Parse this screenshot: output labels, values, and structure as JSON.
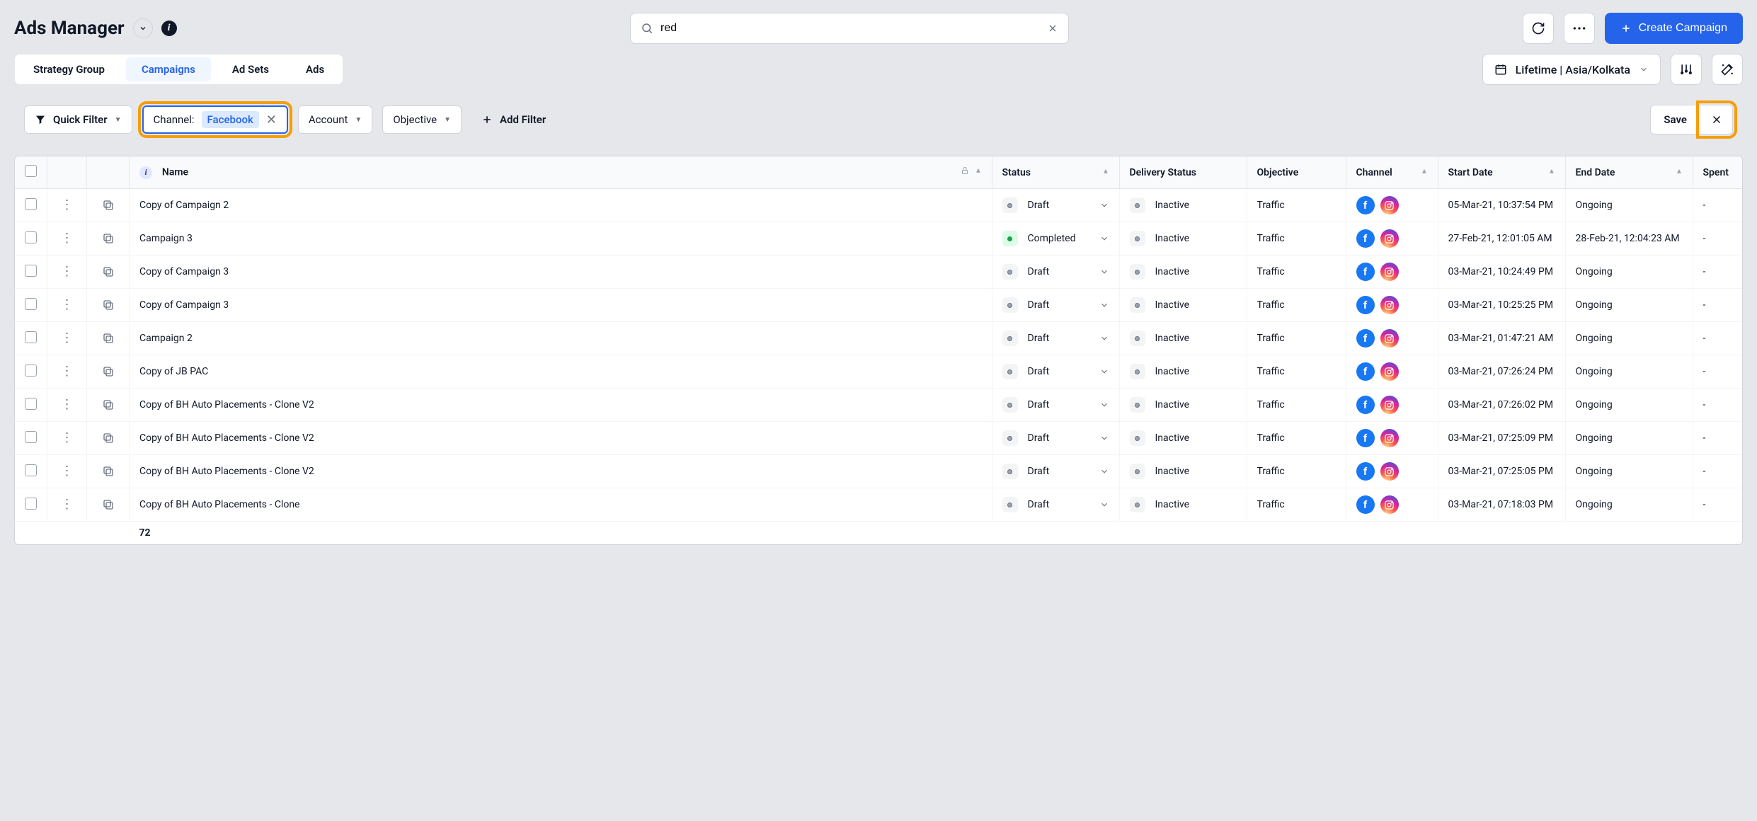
{
  "header": {
    "title": "Ads Manager",
    "search_value": "red",
    "create_label": "Create Campaign"
  },
  "tabs": {
    "items": [
      "Strategy Group",
      "Campaigns",
      "Ad Sets",
      "Ads"
    ],
    "active": 1,
    "date_range": "Lifetime | Asia/Kolkata"
  },
  "filters": {
    "quick_filter": "Quick Filter",
    "channel_label": "Channel:",
    "channel_value": "Facebook",
    "account": "Account",
    "objective": "Objective",
    "add_filter": "Add Filter",
    "save": "Save"
  },
  "table": {
    "headers": {
      "name": "Name",
      "status": "Status",
      "delivery": "Delivery Status",
      "objective": "Objective",
      "channel": "Channel",
      "start": "Start Date",
      "end": "End Date",
      "spent": "Spent"
    },
    "rows": [
      {
        "name": "Copy of Campaign 2",
        "status": "Draft",
        "status_type": "gray",
        "delivery": "Inactive",
        "objective": "Traffic",
        "start": "05-Mar-21, 10:37:54 PM",
        "end": "Ongoing",
        "spent": "-"
      },
      {
        "name": "Campaign 3",
        "status": "Completed",
        "status_type": "green",
        "delivery": "Inactive",
        "objective": "Traffic",
        "start": "27-Feb-21, 12:01:05 AM",
        "end": "28-Feb-21, 12:04:23 AM",
        "spent": "-"
      },
      {
        "name": "Copy of Campaign 3",
        "status": "Draft",
        "status_type": "gray",
        "delivery": "Inactive",
        "objective": "Traffic",
        "start": "03-Mar-21, 10:24:49 PM",
        "end": "Ongoing",
        "spent": "-"
      },
      {
        "name": "Copy of Campaign 3",
        "status": "Draft",
        "status_type": "gray",
        "delivery": "Inactive",
        "objective": "Traffic",
        "start": "03-Mar-21, 10:25:25 PM",
        "end": "Ongoing",
        "spent": "-"
      },
      {
        "name": "Campaign 2",
        "status": "Draft",
        "status_type": "gray",
        "delivery": "Inactive",
        "objective": "Traffic",
        "start": "03-Mar-21, 01:47:21 AM",
        "end": "Ongoing",
        "spent": "-"
      },
      {
        "name": "Copy of JB PAC",
        "status": "Draft",
        "status_type": "gray",
        "delivery": "Inactive",
        "objective": "Traffic",
        "start": "03-Mar-21, 07:26:24 PM",
        "end": "Ongoing",
        "spent": "-"
      },
      {
        "name": "Copy of BH Auto Placements - Clone V2",
        "status": "Draft",
        "status_type": "gray",
        "delivery": "Inactive",
        "objective": "Traffic",
        "start": "03-Mar-21, 07:26:02 PM",
        "end": "Ongoing",
        "spent": "-"
      },
      {
        "name": "Copy of BH Auto Placements - Clone V2",
        "status": "Draft",
        "status_type": "gray",
        "delivery": "Inactive",
        "objective": "Traffic",
        "start": "03-Mar-21, 07:25:09 PM",
        "end": "Ongoing",
        "spent": "-"
      },
      {
        "name": "Copy of BH Auto Placements - Clone V2",
        "status": "Draft",
        "status_type": "gray",
        "delivery": "Inactive",
        "objective": "Traffic",
        "start": "03-Mar-21, 07:25:05 PM",
        "end": "Ongoing",
        "spent": "-"
      },
      {
        "name": "Copy of BH Auto Placements - Clone",
        "status": "Draft",
        "status_type": "gray",
        "delivery": "Inactive",
        "objective": "Traffic",
        "start": "03-Mar-21, 07:18:03 PM",
        "end": "Ongoing",
        "spent": "-"
      }
    ],
    "footer_count": "72"
  }
}
